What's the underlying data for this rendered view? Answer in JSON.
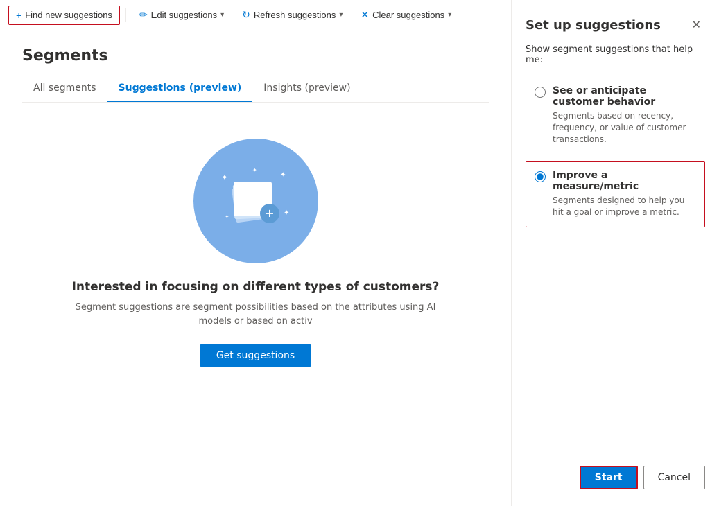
{
  "toolbar": {
    "find_new_suggestions_label": "Find new suggestions",
    "edit_suggestions_label": "Edit suggestions",
    "refresh_suggestions_label": "Refresh suggestions",
    "clear_suggestions_label": "Clear suggestions"
  },
  "page": {
    "title": "Segments",
    "tabs": [
      {
        "id": "all-segments",
        "label": "All segments",
        "active": false
      },
      {
        "id": "suggestions-preview",
        "label": "Suggestions (preview)",
        "active": true
      },
      {
        "id": "insights-preview",
        "label": "Insights (preview)",
        "active": false
      }
    ]
  },
  "hero": {
    "title": "Interested in focusing on different types of customers?",
    "description": "Segment suggestions are segment possibilities based on the attributes using AI models or based on activ",
    "get_suggestions_label": "Get suggestions"
  },
  "panel": {
    "title": "Set up suggestions",
    "subtitle": "Show segment suggestions that help me:",
    "options": [
      {
        "id": "customer-behavior",
        "label": "See or anticipate customer behavior",
        "description": "Segments based on recency, frequency, or value of customer transactions.",
        "selected": false
      },
      {
        "id": "improve-metric",
        "label": "Improve a measure/metric",
        "description": "Segments designed to help you hit a goal or improve a metric.",
        "selected": true
      }
    ],
    "start_label": "Start",
    "cancel_label": "Cancel"
  }
}
